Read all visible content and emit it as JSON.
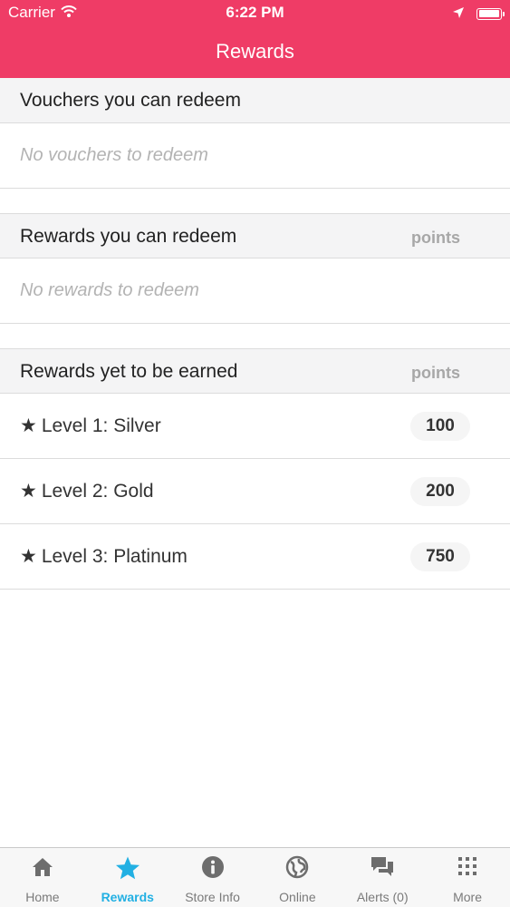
{
  "status_bar": {
    "carrier": "Carrier",
    "time": "6:22 PM"
  },
  "nav": {
    "title": "Rewards"
  },
  "sections": {
    "vouchers": {
      "title": "Vouchers you can redeem",
      "empty": "No vouchers to redeem"
    },
    "redeemable": {
      "title": "Rewards you can redeem",
      "points_label": "points",
      "empty": "No rewards to redeem"
    },
    "yet_to_earn": {
      "title": "Rewards yet to be earned",
      "points_label": "points",
      "items": [
        {
          "star": "★",
          "label": "Level 1: Silver",
          "points": "100"
        },
        {
          "star": "★",
          "label": "Level 2: Gold",
          "points": "200"
        },
        {
          "star": "★",
          "label": "Level 3: Platinum",
          "points": "750"
        }
      ]
    }
  },
  "tabbar": {
    "tabs": [
      {
        "label": "Home",
        "icon": "home-icon"
      },
      {
        "label": "Rewards",
        "icon": "star-icon",
        "active": true
      },
      {
        "label": "Store Info",
        "icon": "info-icon"
      },
      {
        "label": "Online",
        "icon": "globe-icon"
      },
      {
        "label": "Alerts (0)",
        "icon": "chat-icon"
      },
      {
        "label": "More",
        "icon": "grid-icon"
      }
    ]
  },
  "colors": {
    "header": "#ef3c66",
    "active_tab": "#22b0e3",
    "inactive_tab": "#7a7a7a"
  }
}
